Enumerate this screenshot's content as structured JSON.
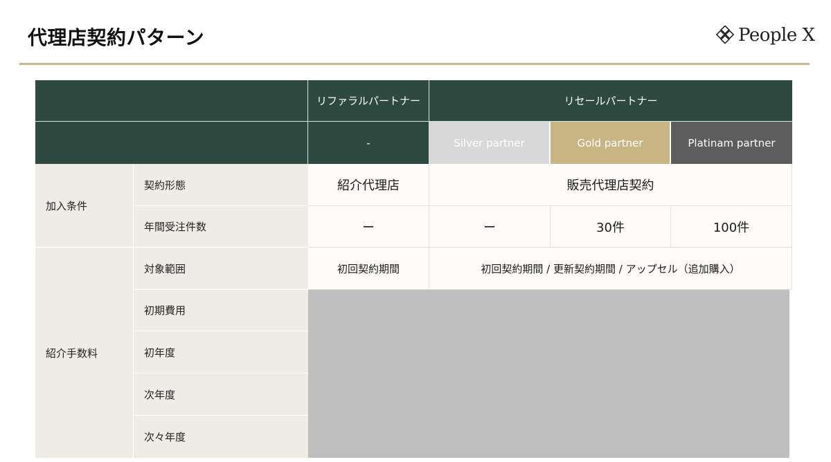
{
  "header": {
    "title": "代理店契約パターン",
    "logo_text": "People X",
    "logo_icon": "diamond-lattice-icon"
  },
  "colors": {
    "header_green": "#2e4a40",
    "accent_rule": "#c9b98f",
    "silver": "#d8d8d8",
    "gold": "#c8b583",
    "platinum": "#5d5d5d",
    "label_bg": "#efece6",
    "masked": "#bfbfbf"
  },
  "table": {
    "col_groups": {
      "referral": "リファラルパートナー",
      "resale": "リセールパートナー"
    },
    "tiers": {
      "referral_tier": "-",
      "silver": "Silver partner",
      "gold": "Gold partner",
      "platinum": "Platinam partner"
    },
    "categories": {
      "join": "加入条件",
      "fee": "紹介手数料"
    },
    "rows": {
      "contract_type": {
        "label": "契約形態",
        "referral": "紹介代理店",
        "resale": "販売代理店契約"
      },
      "annual_orders": {
        "label": "年間受注件数",
        "referral": "ー",
        "silver": "ー",
        "gold": "30件",
        "platinum": "100件"
      },
      "scope": {
        "label": "対象範囲",
        "referral": "初回契約期間",
        "resale": "初回契約期間 / 更新契約期間 / アップセル（追加購入）"
      },
      "initial_cost": {
        "label": "初期費用"
      },
      "first_year": {
        "label": "初年度"
      },
      "second_year": {
        "label": "次年度"
      },
      "third_year": {
        "label": "次々年度"
      }
    }
  }
}
